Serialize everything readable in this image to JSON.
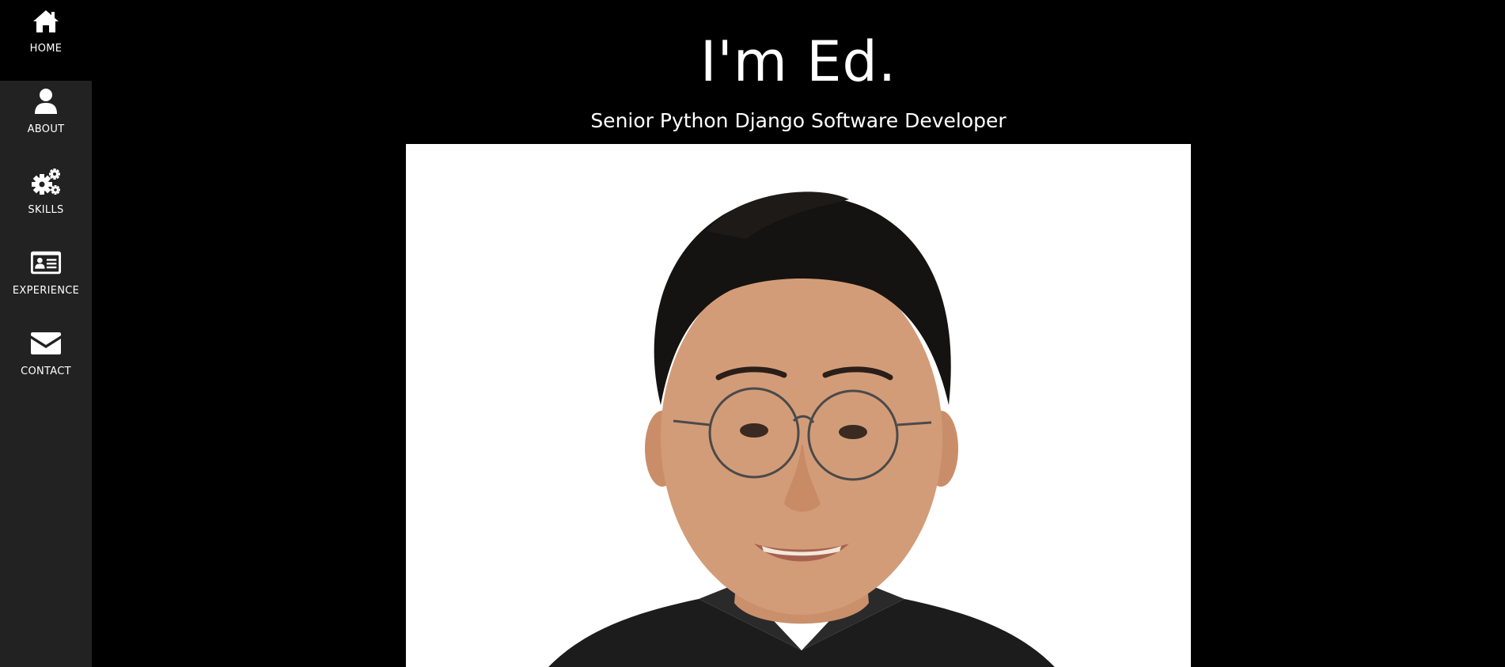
{
  "sidebar": {
    "items": [
      {
        "label": "HOME",
        "icon": "home-icon",
        "active": true
      },
      {
        "label": "ABOUT",
        "icon": "user-icon",
        "active": false
      },
      {
        "label": "SKILLS",
        "icon": "gears-icon",
        "active": false
      },
      {
        "label": "EXPERIENCE",
        "icon": "id-card-icon",
        "active": false
      },
      {
        "label": "CONTACT",
        "icon": "envelope-icon",
        "active": false
      }
    ]
  },
  "hero": {
    "title": "I'm Ed.",
    "subtitle": "Senior Python Django Software Developer",
    "image": "portrait-photo"
  },
  "colors": {
    "background": "#000000",
    "sidebar": "#222222",
    "text": "#ffffff",
    "photo_background": "#ffffff"
  }
}
